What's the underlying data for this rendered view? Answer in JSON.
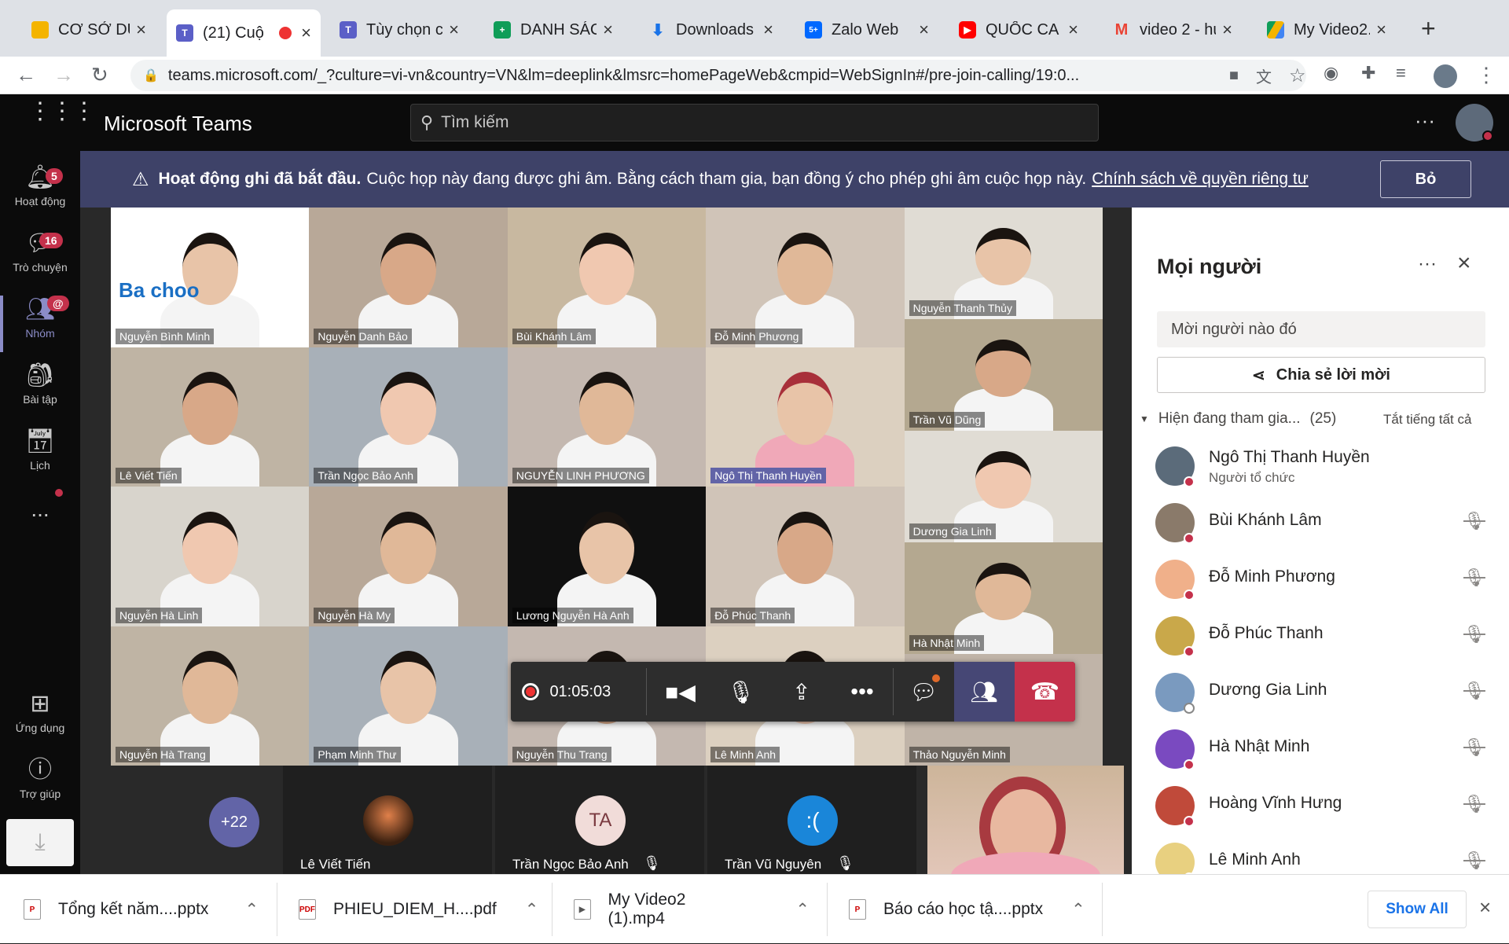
{
  "browser": {
    "tabs": [
      {
        "title": "CƠ SỞ DỮ",
        "icon": "google-drive-icon"
      },
      {
        "title": "(21) Cuộ",
        "icon": "teams-icon",
        "active": true
      },
      {
        "title": "Tùy chọn c",
        "icon": "teams-icon"
      },
      {
        "title": "DANH SÁCH",
        "icon": "sheets-icon"
      },
      {
        "title": "Downloads",
        "icon": "download-icon"
      },
      {
        "title": "Zalo Web",
        "icon": "zalo-icon",
        "badge": "5+"
      },
      {
        "title": "QUỐC CA",
        "icon": "youtube-icon"
      },
      {
        "title": "video 2 - hu",
        "icon": "gmail-icon"
      },
      {
        "title": "My Video2.",
        "icon": "google-drive-icon"
      }
    ],
    "url": "teams.microsoft.com/_?culture=vi-vn&country=VN&lm=deeplink&lmsrc=homePageWeb&cmpid=WebSignIn#/pre-join-calling/19:0..."
  },
  "teams": {
    "app_title": "Microsoft Teams",
    "search_placeholder": "Tìm kiếm",
    "rail": [
      {
        "label": "Hoạt động",
        "badge": "5"
      },
      {
        "label": "Trò chuyện",
        "badge": "16"
      },
      {
        "label": "Nhóm",
        "badge": "@"
      },
      {
        "label": "Bài tập"
      },
      {
        "label": "Lịch"
      },
      {
        "label": "..."
      }
    ],
    "rail_bottom": [
      {
        "label": "Ứng dụng"
      },
      {
        "label": "Trợ giúp"
      }
    ]
  },
  "banner": {
    "bold": "Hoạt động ghi đã bắt đầu.",
    "text": "Cuộc họp này đang được ghi âm. Bằng cách tham gia, bạn đồng ý cho phép ghi âm cuộc họp này.",
    "link": "Chính sách về quyền riêng tư",
    "dismiss": "Bỏ"
  },
  "grid": [
    [
      "Nguyễn Bình Minh",
      "Nguyễn Danh Bảo",
      "Bùi Khánh Lâm",
      "Đỗ Minh Phương",
      "Nguyễn Thanh Thủy"
    ],
    [
      "Lê Viết Tiến",
      "Trần Ngọc Bảo Anh",
      "NGUYỄN LINH PHƯƠNG",
      "Ngô Thị Thanh Huyền",
      "Trần Vũ Dũng"
    ],
    [
      "Nguyễn Hà Linh",
      "Nguyễn Hà My",
      "Lương Nguyễn Hà Anh",
      "Đỗ Phúc Thanh",
      "Dương Gia Linh"
    ],
    [
      "Nguyễn Hà Trang",
      "Phạm Minh Thư",
      "Nguyễn Thu Trang",
      "Lê Minh Anh",
      "Hà Nhật Minh"
    ]
  ],
  "grid_extra": "Thảo Nguyễn Minh",
  "logo_text": "Ba  choo",
  "controls": {
    "timer": "01:05:03"
  },
  "bottom": {
    "more": "+22",
    "tiles": [
      {
        "name": "Lê Viết Tiến"
      },
      {
        "name": "Trần Ngọc Bảo Anh",
        "initials": "TA"
      },
      {
        "name": "Trần Vũ Nguyên"
      }
    ]
  },
  "people": {
    "title": "Mọi người",
    "invite_placeholder": "Mời người nào đó",
    "share_invite": "Chia sẻ lời mời",
    "section": "Hiện đang tham gia...",
    "count": "(25)",
    "mute_all": "Tắt tiếng tất cả",
    "list": [
      {
        "name": "Ngô Thị Thanh Huyền",
        "role": "Người tổ chức",
        "color": "#5b6b7a"
      },
      {
        "name": "Bùi Khánh Lâm",
        "color": "#8a7a6a"
      },
      {
        "name": "Đỗ Minh Phương",
        "color": "#f0b08a"
      },
      {
        "name": "Đỗ Phúc Thanh",
        "color": "#c9a84a"
      },
      {
        "name": "Dương Gia Linh",
        "color": "#7a9abf"
      },
      {
        "name": "Hà Nhật Minh",
        "color": "#7a4ac0"
      },
      {
        "name": "Hoàng Vĩnh Hưng",
        "color": "#c04a3a"
      },
      {
        "name": "Lê Minh Anh",
        "color": "#e8d080"
      }
    ]
  },
  "downloads": {
    "items": [
      "Tổng kết năm....pptx",
      "PHIEU_DIEM_H....pdf",
      "My Video2 (1).mp4",
      "Báo cáo học tậ....pptx"
    ],
    "show_all": "Show All"
  }
}
